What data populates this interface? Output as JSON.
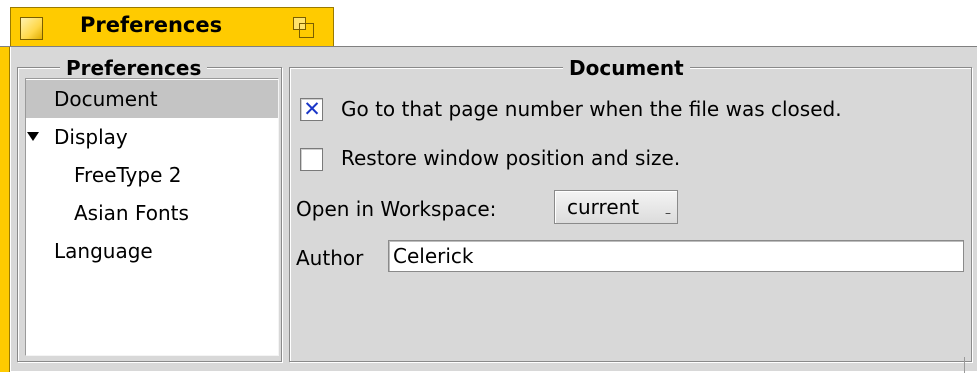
{
  "window": {
    "title": "Preferences",
    "close_icon": "close-box-icon",
    "zoom_icon": "zoom-box-icon",
    "accent_color": "#ffcb00"
  },
  "sidebar": {
    "legend": "Preferences",
    "items": [
      {
        "label": "Document",
        "selected": true,
        "level": 0
      },
      {
        "label": "Display",
        "expanded": true,
        "level": 0
      },
      {
        "label": "FreeType 2",
        "level": 1
      },
      {
        "label": "Asian Fonts",
        "level": 1
      },
      {
        "label": "Language",
        "level": 0
      }
    ]
  },
  "document": {
    "legend": "Document",
    "goto_page_checkbox": {
      "label": "Go to that page number when the file was closed.",
      "checked": true
    },
    "restore_window_checkbox": {
      "label": "Restore window position and size.",
      "checked": false
    },
    "workspace": {
      "label": "Open in Workspace:",
      "value": "current"
    },
    "author": {
      "label": "Author",
      "value": "Celerick"
    }
  }
}
